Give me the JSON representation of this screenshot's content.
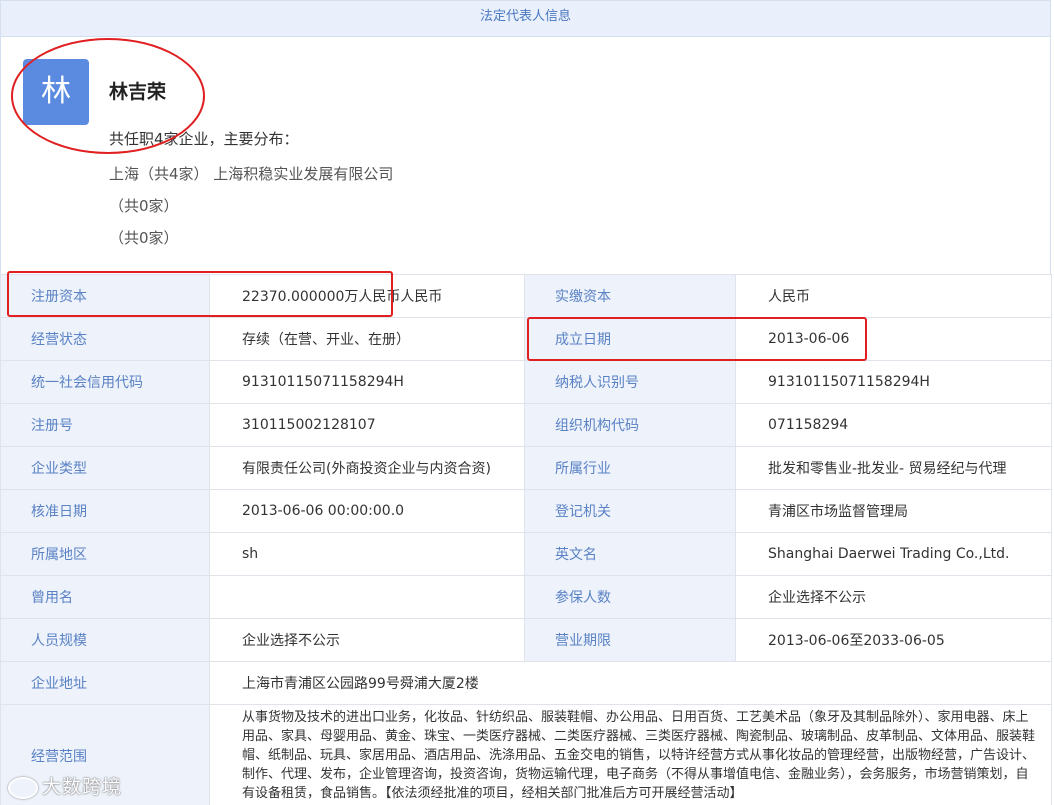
{
  "header": {
    "title": "法定代表人信息"
  },
  "person": {
    "avatar_char": "林",
    "name": "林吉荣",
    "summary": "共任职4家企业，主要分布：",
    "lines": [
      "上海（共4家） 上海积稳实业发展有限公司",
      "（共0家）",
      "（共0家）"
    ]
  },
  "table": {
    "rows": [
      {
        "l1": "注册资本",
        "v1": "22370.000000万人民币人民币",
        "l2": "实缴资本",
        "v2": "人民币"
      },
      {
        "l1": "经营状态",
        "v1": "存续（在营、开业、在册）",
        "l2": "成立日期",
        "v2": "2013-06-06"
      },
      {
        "l1": "统一社会信用代码",
        "v1": "91310115071158294H",
        "l2": "纳税人识别号",
        "v2": "91310115071158294H"
      },
      {
        "l1": "注册号",
        "v1": "310115002128107",
        "l2": "组织机构代码",
        "v2": "071158294"
      },
      {
        "l1": "企业类型",
        "v1": "有限责任公司(外商投资企业与内资合资)",
        "l2": "所属行业",
        "v2": "批发和零售业-批发业- 贸易经纪与代理"
      },
      {
        "l1": "核准日期",
        "v1": "2013-06-06 00:00:00.0",
        "l2": "登记机关",
        "v2": "青浦区市场监督管理局"
      },
      {
        "l1": "所属地区",
        "v1": "sh",
        "l2": "英文名",
        "v2": "Shanghai Daerwei Trading Co.,Ltd."
      },
      {
        "l1": "曾用名",
        "v1": "",
        "l2": "参保人数",
        "v2": "企业选择不公示"
      },
      {
        "l1": "人员规模",
        "v1": "企业选择不公示",
        "l2": "营业期限",
        "v2": "2013-06-06至2033-06-05"
      }
    ],
    "address_label": "企业地址",
    "address_value": "上海市青浦区公园路99号舜浦大厦2楼",
    "scope_label": "经营范围",
    "scope_value": "从事货物及技术的进出口业务，化妆品、针纺织品、服装鞋帽、办公用品、日用百货、工艺美术品（象牙及其制品除外）、家用电器、床上用品、家具、母婴用品、黄金、珠宝、一类医疗器械、二类医疗器械、三类医疗器械、陶瓷制品、玻璃制品、皮革制品、文体用品、服装鞋帽、纸制品、玩具、家居用品、酒店用品、洗涤用品、五金交电的销售，以特许经营方式从事化妆品的管理经营，出版物经营，广告设计、制作、代理、发布，企业管理咨询，投资咨询，货物运输代理，电子商务（不得从事增值电信、金融业务），会务服务，市场营销策划，自有设备租赁，食品销售。【依法须经批准的项目，经相关部门批准后方可开展经营活动】"
  },
  "watermark": {
    "text": "大数跨境"
  },
  "colors": {
    "annotation_red": "#e02020",
    "avatar_blue": "#5b8be0",
    "label_blue": "#5a82c4"
  }
}
